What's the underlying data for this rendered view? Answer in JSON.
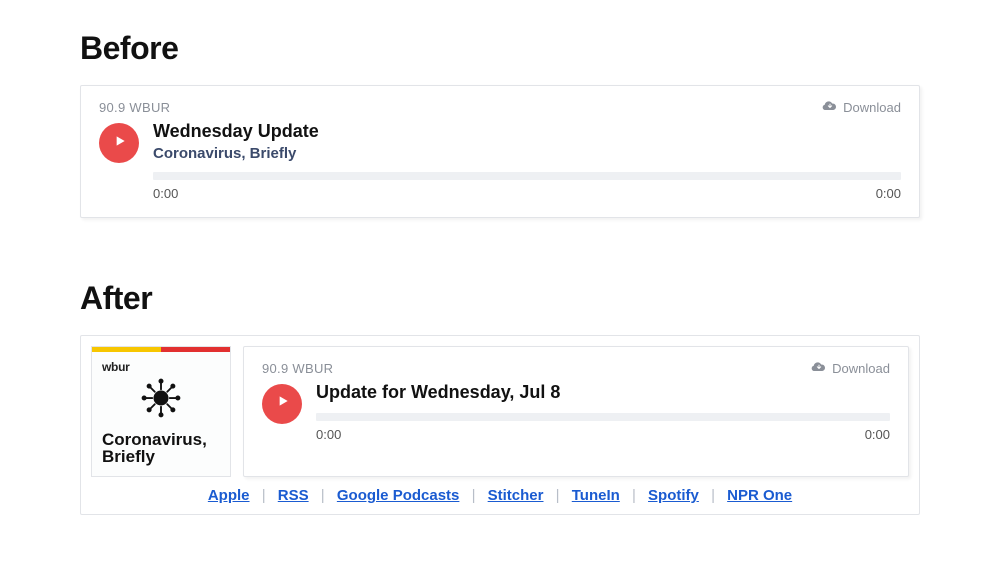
{
  "sections": {
    "before": {
      "heading": "Before"
    },
    "after": {
      "heading": "After"
    }
  },
  "before_player": {
    "station": "90.9 WBUR",
    "download": "Download",
    "title": "Wednesday Update",
    "subtitle": "Coronavirus, Briefly",
    "time_elapsed": "0:00",
    "time_total": "0:00"
  },
  "after_artwork": {
    "brand": "wbur",
    "title_line1": "Coronavirus,",
    "title_line2": "Briefly"
  },
  "after_player": {
    "station": "90.9 WBUR",
    "download": "Download",
    "title": "Update for Wednesday, Jul 8",
    "time_elapsed": "0:00",
    "time_total": "0:00"
  },
  "subscribe": {
    "links": [
      "Apple",
      "RSS",
      "Google Podcasts",
      "Stitcher",
      "TuneIn",
      "Spotify",
      "NPR One"
    ]
  }
}
